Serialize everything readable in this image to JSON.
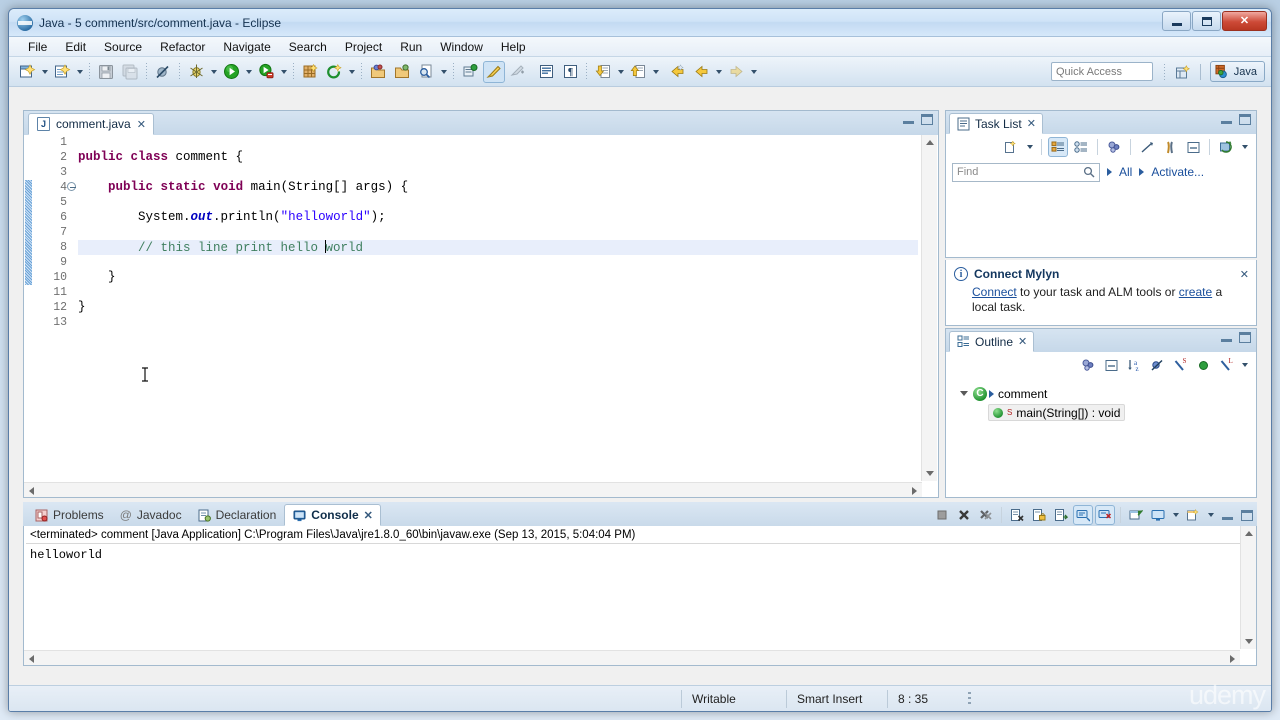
{
  "window": {
    "title": "Java - 5 comment/src/comment.java - Eclipse",
    "app_icon": "eclipse-icon",
    "minimize_label": "Minimize",
    "maximize_label": "Maximize",
    "close_label": "Close"
  },
  "menu": {
    "items": [
      {
        "label": "File"
      },
      {
        "label": "Edit"
      },
      {
        "label": "Source"
      },
      {
        "label": "Refactor"
      },
      {
        "label": "Navigate"
      },
      {
        "label": "Search"
      },
      {
        "label": "Project"
      },
      {
        "label": "Run"
      },
      {
        "label": "Window"
      },
      {
        "label": "Help"
      }
    ]
  },
  "toolbar": {
    "quick_access_placeholder": "Quick Access",
    "perspective_label": "Java",
    "new_perspective_tooltip": "Open Perspective",
    "buttons": [
      {
        "name": "new-wizard-icon"
      },
      {
        "name": "new-java-class-icon"
      },
      {
        "name": "save-icon"
      },
      {
        "name": "save-all-icon"
      },
      {
        "name": "skip-breakpoints-icon"
      },
      {
        "name": "debug-icon"
      },
      {
        "name": "run-icon"
      },
      {
        "name": "run-external-tools-icon"
      },
      {
        "name": "new-java-project-icon"
      },
      {
        "name": "new-annotation-icon"
      },
      {
        "name": "open-type-icon"
      },
      {
        "name": "open-task-icon"
      },
      {
        "name": "search-icon"
      },
      {
        "name": "toggle-mylyn-icon"
      },
      {
        "name": "focus-active-task-icon"
      },
      {
        "name": "previous-annotation-icon"
      },
      {
        "name": "next-annotation-icon"
      },
      {
        "name": "last-edit-location-icon"
      },
      {
        "name": "back-icon"
      },
      {
        "name": "forward-icon"
      }
    ]
  },
  "editor": {
    "tab_label": "comment.java",
    "tab_icon": "java-file-icon",
    "minimize_label": "Minimize",
    "maximize_label": "Maximize",
    "line_numbers": [
      1,
      2,
      3,
      4,
      5,
      6,
      7,
      8,
      9,
      10,
      11,
      12,
      13
    ],
    "change_bar_lines": [
      4,
      5,
      6,
      7,
      8,
      9,
      10
    ],
    "fold_marker_line": 4,
    "highlighted_line": 8,
    "caret_line": 8,
    "lines": [
      {
        "n": 1,
        "tokens": []
      },
      {
        "n": 2,
        "tokens": [
          {
            "t": "kw",
            "s": "public"
          },
          {
            "t": "plain",
            "s": " "
          },
          {
            "t": "kw",
            "s": "class"
          },
          {
            "t": "plain",
            "s": " comment {"
          }
        ]
      },
      {
        "n": 3,
        "tokens": []
      },
      {
        "n": 4,
        "tokens": [
          {
            "t": "plain",
            "s": "    "
          },
          {
            "t": "kw",
            "s": "public"
          },
          {
            "t": "plain",
            "s": " "
          },
          {
            "t": "kw",
            "s": "static"
          },
          {
            "t": "plain",
            "s": " "
          },
          {
            "t": "kw",
            "s": "void"
          },
          {
            "t": "plain",
            "s": " main(String[] args) {"
          }
        ]
      },
      {
        "n": 5,
        "tokens": []
      },
      {
        "n": 6,
        "tokens": [
          {
            "t": "plain",
            "s": "        System."
          },
          {
            "t": "fld",
            "s": "out"
          },
          {
            "t": "plain",
            "s": ".println("
          },
          {
            "t": "str",
            "s": "\"helloworld\""
          },
          {
            "t": "plain",
            "s": ");"
          }
        ]
      },
      {
        "n": 7,
        "tokens": []
      },
      {
        "n": 8,
        "tokens": [
          {
            "t": "plain",
            "s": "        "
          },
          {
            "t": "cmt",
            "s": "// this line print hello "
          },
          {
            "t": "caret",
            "s": ""
          },
          {
            "t": "cmt",
            "s": "world"
          }
        ]
      },
      {
        "n": 9,
        "tokens": []
      },
      {
        "n": 10,
        "tokens": [
          {
            "t": "plain",
            "s": "    }"
          }
        ]
      },
      {
        "n": 11,
        "tokens": []
      },
      {
        "n": 12,
        "tokens": [
          {
            "t": "plain",
            "s": "}"
          }
        ]
      },
      {
        "n": 13,
        "tokens": []
      }
    ]
  },
  "task_list": {
    "tab_label": "Task List",
    "tab_icon": "task-list-icon",
    "close_icon": "close-icon",
    "find_placeholder": "Find",
    "search_icon": "search-icon",
    "all_label": "All",
    "activate_label": "Activate...",
    "toolbar_icons": [
      "new-task-icon",
      "dropdown-arrow-icon",
      "categorized-presentation-icon",
      "scheduled-presentation-icon",
      "focus-on-workweek-icon",
      "collapse-all-icon",
      "filter-icon",
      "minimize-icon",
      "synchronize-icon",
      "view-menu-icon"
    ]
  },
  "mylyn": {
    "title": "Connect Mylyn",
    "info_icon": "info-icon",
    "close_icon": "close-icon",
    "text_before": "",
    "link_connect": "Connect",
    "text_middle": " to your task and ALM tools or ",
    "link_create": "create",
    "text_after": " a local task."
  },
  "outline": {
    "tab_label": "Outline",
    "tab_icon": "outline-icon",
    "close_icon": "close-icon",
    "toolbar_icons": [
      "focus-on-active-task-icon",
      "collapse-all-icon",
      "sort-alphabetically-icon",
      "hide-fields-icon",
      "hide-static-icon",
      "hide-non-public-icon",
      "hide-local-types-icon",
      "view-menu-icon"
    ],
    "tree": [
      {
        "label": "comment",
        "icon": "java-class-icon",
        "level": 0,
        "expanded": true,
        "selected": false
      },
      {
        "label": "main(String[]) : void",
        "icon": "public-method-icon",
        "modifier": "S",
        "level": 1,
        "selected": true
      }
    ]
  },
  "console": {
    "tabs": [
      {
        "label": "Problems",
        "icon": "problems-icon",
        "active": false
      },
      {
        "label": "Javadoc",
        "icon": "javadoc-icon",
        "active": false
      },
      {
        "label": "Declaration",
        "icon": "declaration-icon",
        "active": false
      },
      {
        "label": "Console",
        "icon": "console-icon",
        "active": true
      }
    ],
    "close_icon": "close-icon",
    "header_line": "<terminated> comment [Java Application] C:\\Program Files\\Java\\jre1.8.0_60\\bin\\javaw.exe (Sep 13, 2015, 5:04:04 PM)",
    "output": "helloworld",
    "toolbar_icons": [
      "terminate-icon",
      "remove-launch-icon",
      "remove-all-terminated-icon",
      "clear-console-icon",
      "scroll-lock-icon",
      "word-wrap-icon",
      "show-console-on-output-icon",
      "show-console-on-error-icon",
      "pin-console-icon",
      "display-selected-console-icon",
      "dropdown-arrow-icon",
      "open-console-icon",
      "dropdown-arrow-icon",
      "minimize-icon",
      "maximize-icon"
    ]
  },
  "status_bar": {
    "writable": "Writable",
    "insert_mode": "Smart Insert",
    "position": "8 : 35"
  },
  "watermark": "udemy",
  "colors": {
    "keyword": "#7f0055",
    "string": "#2a00ff",
    "comment": "#3f7f5f",
    "field": "#0000c0",
    "line_highlight": "#e8eefb",
    "link": "#1a4f9c",
    "accent": "#2b6ca3"
  }
}
